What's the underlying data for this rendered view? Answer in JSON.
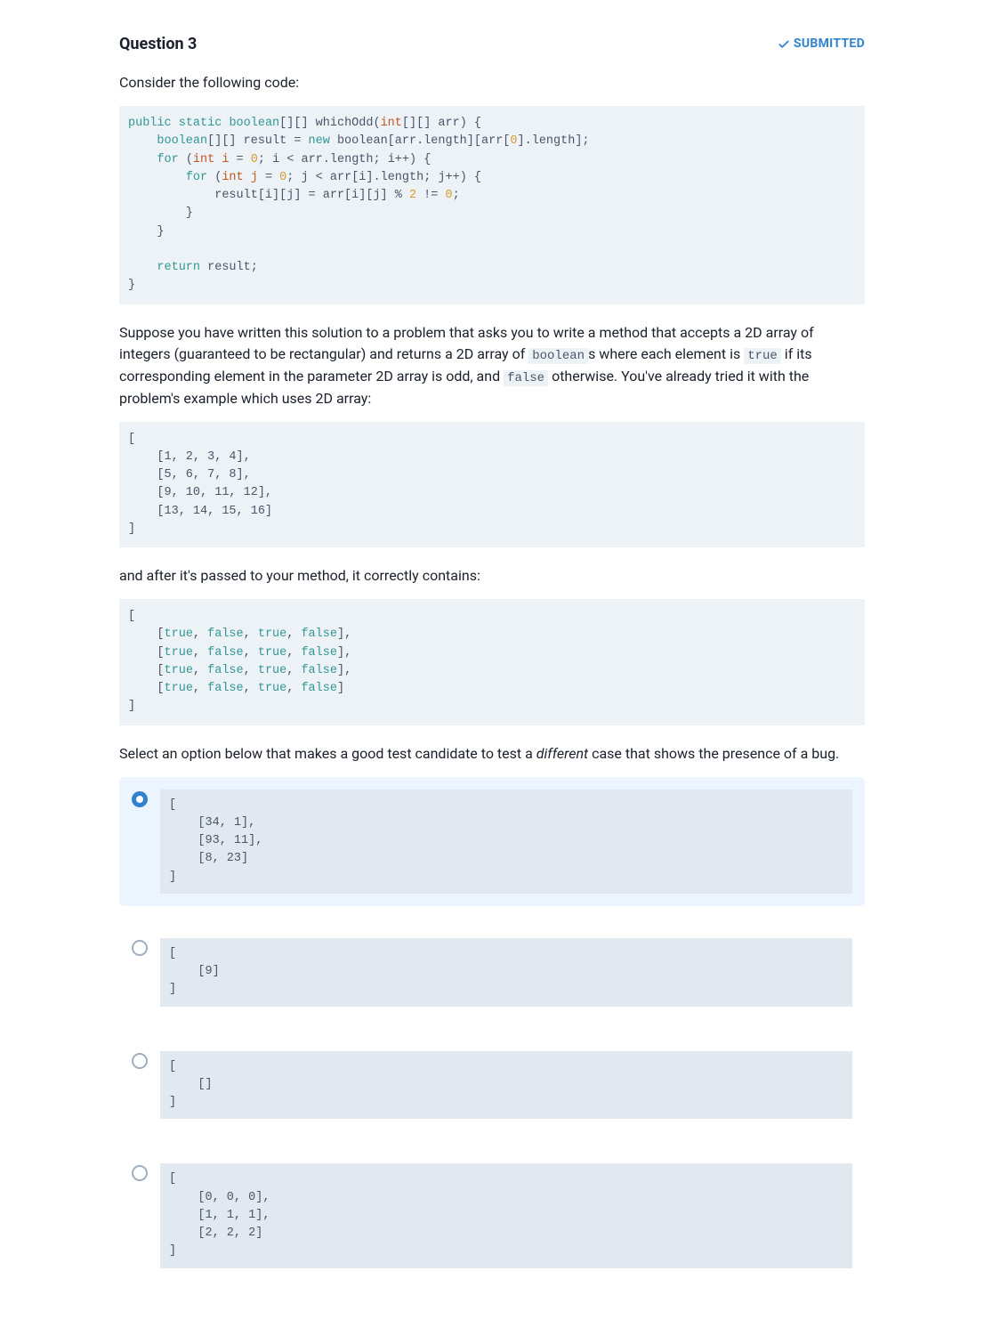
{
  "header": {
    "title": "Question 3",
    "status": "SUBMITTED"
  },
  "intro": "Consider the following code:",
  "code1_tokens": [
    {
      "t": "public",
      "c": "kw1"
    },
    {
      "t": " "
    },
    {
      "t": "static",
      "c": "kw1"
    },
    {
      "t": " "
    },
    {
      "t": "boolean",
      "c": "kw1"
    },
    {
      "t": "[][] whichOdd("
    },
    {
      "t": "int",
      "c": "kw2"
    },
    {
      "t": "[][] arr) {\n"
    },
    {
      "t": "    "
    },
    {
      "t": "boolean",
      "c": "kw1"
    },
    {
      "t": "[][] result = "
    },
    {
      "t": "new",
      "c": "kw1"
    },
    {
      "t": " boolean[arr.length][arr["
    },
    {
      "t": "0",
      "c": "num"
    },
    {
      "t": "].length];\n"
    },
    {
      "t": "    "
    },
    {
      "t": "for",
      "c": "kw1"
    },
    {
      "t": " ("
    },
    {
      "t": "int",
      "c": "kw2"
    },
    {
      "t": " "
    },
    {
      "t": "i",
      "c": "var"
    },
    {
      "t": " = "
    },
    {
      "t": "0",
      "c": "num"
    },
    {
      "t": "; i < arr.length; i++) {\n"
    },
    {
      "t": "        "
    },
    {
      "t": "for",
      "c": "kw1"
    },
    {
      "t": " ("
    },
    {
      "t": "int",
      "c": "kw2"
    },
    {
      "t": " "
    },
    {
      "t": "j",
      "c": "var"
    },
    {
      "t": " = "
    },
    {
      "t": "0",
      "c": "num"
    },
    {
      "t": "; j < arr[i].length; j++) {\n"
    },
    {
      "t": "            result[i][j] = arr[i][j] % "
    },
    {
      "t": "2",
      "c": "num"
    },
    {
      "t": " != "
    },
    {
      "t": "0",
      "c": "num"
    },
    {
      "t": ";\n"
    },
    {
      "t": "        }\n"
    },
    {
      "t": "    }\n"
    },
    {
      "t": "\n"
    },
    {
      "t": "    "
    },
    {
      "t": "return",
      "c": "kw1"
    },
    {
      "t": " result;\n"
    },
    {
      "t": "}"
    }
  ],
  "para1_parts": [
    {
      "t": "Suppose you have written this solution to a problem that asks you to write a method that accepts a 2D array of integers (guaranteed to be rectangular) and returns a 2D array of "
    },
    {
      "t": "boolean",
      "code": true
    },
    {
      "t": "s where each element is "
    },
    {
      "t": "true",
      "code": true
    },
    {
      "t": " if its corresponding element in the parameter 2D array is odd, and "
    },
    {
      "t": "false",
      "code": true
    },
    {
      "t": " otherwise. You've already tried it with the problem's example which uses 2D array:"
    }
  ],
  "code2": "[\n    [1, 2, 3, 4],\n    [5, 6, 7, 8],\n    [9, 10, 11, 12],\n    [13, 14, 15, 16]\n]",
  "para2": "and after it's passed to your method, it correctly contains:",
  "code3_tokens": [
    {
      "t": "[\n"
    },
    {
      "t": "    ["
    },
    {
      "t": "true",
      "c": "bool"
    },
    {
      "t": ", "
    },
    {
      "t": "false",
      "c": "bool"
    },
    {
      "t": ", "
    },
    {
      "t": "true",
      "c": "bool"
    },
    {
      "t": ", "
    },
    {
      "t": "false",
      "c": "bool"
    },
    {
      "t": "],\n"
    },
    {
      "t": "    ["
    },
    {
      "t": "true",
      "c": "bool"
    },
    {
      "t": ", "
    },
    {
      "t": "false",
      "c": "bool"
    },
    {
      "t": ", "
    },
    {
      "t": "true",
      "c": "bool"
    },
    {
      "t": ", "
    },
    {
      "t": "false",
      "c": "bool"
    },
    {
      "t": "],\n"
    },
    {
      "t": "    ["
    },
    {
      "t": "true",
      "c": "bool"
    },
    {
      "t": ", "
    },
    {
      "t": "false",
      "c": "bool"
    },
    {
      "t": ", "
    },
    {
      "t": "true",
      "c": "bool"
    },
    {
      "t": ", "
    },
    {
      "t": "false",
      "c": "bool"
    },
    {
      "t": "],\n"
    },
    {
      "t": "    ["
    },
    {
      "t": "true",
      "c": "bool"
    },
    {
      "t": ", "
    },
    {
      "t": "false",
      "c": "bool"
    },
    {
      "t": ", "
    },
    {
      "t": "true",
      "c": "bool"
    },
    {
      "t": ", "
    },
    {
      "t": "false",
      "c": "bool"
    },
    {
      "t": "]\n"
    },
    {
      "t": "]"
    }
  ],
  "para3_parts": [
    {
      "t": "Select an option below that makes a good test candidate to test a "
    },
    {
      "t": "different",
      "em": true
    },
    {
      "t": " case that shows the presence of a bug."
    }
  ],
  "options": [
    {
      "selected": true,
      "code": "[\n    [34, 1],\n    [93, 11],\n    [8, 23]\n]"
    },
    {
      "selected": false,
      "code": "[\n    [9]\n]"
    },
    {
      "selected": false,
      "code": "[\n    []\n]"
    },
    {
      "selected": false,
      "code": "[\n    [0, 0, 0],\n    [1, 1, 1],\n    [2, 2, 2]\n]"
    }
  ]
}
